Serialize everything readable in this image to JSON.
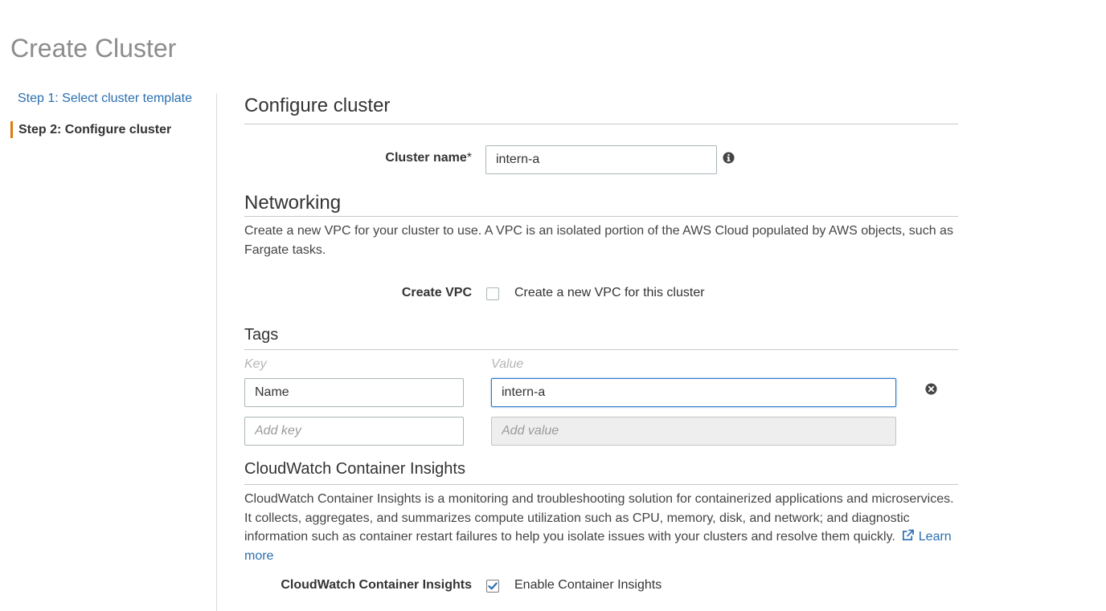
{
  "page": {
    "title": "Create Cluster"
  },
  "steps": [
    {
      "label": "Step 1: Select cluster template"
    },
    {
      "label": "Step 2: Configure cluster"
    }
  ],
  "configure": {
    "title": "Configure cluster",
    "cluster_name_label": "Cluster name",
    "required_mark": "*",
    "cluster_name_value": "intern-a"
  },
  "networking": {
    "title": "Networking",
    "description": "Create a new VPC for your cluster to use. A VPC is an isolated portion of the AWS Cloud populated by AWS objects, such as Fargate tasks.",
    "create_vpc_label": "Create VPC",
    "create_vpc_checkbox_label": "Create a new VPC for this cluster",
    "create_vpc_checked": false
  },
  "tags": {
    "title": "Tags",
    "key_header": "Key",
    "value_header": "Value",
    "rows": [
      {
        "key": "Name",
        "value": "intern-a"
      }
    ],
    "add_key_placeholder": "Add key",
    "add_value_placeholder": "Add value"
  },
  "insights": {
    "title": "CloudWatch Container Insights",
    "description": "CloudWatch Container Insights is a monitoring and troubleshooting solution for containerized applications and microservices. It collects, aggregates, and summarizes compute utilization such as CPU, memory, disk, and network; and diagnostic information such as container restart failures to help you isolate issues with your clusters and resolve them quickly.",
    "learn_more": "Learn more",
    "field_label": "CloudWatch Container Insights",
    "checkbox_label": "Enable Container Insights",
    "enabled": true
  },
  "icons": {
    "info": "info-icon",
    "remove": "remove-tag-icon",
    "external": "external-link-icon",
    "check": "checkmark-icon"
  },
  "colors": {
    "link": "#2a6fb0",
    "active_step_bar": "#e07a10",
    "focus_border": "#2e7bc6"
  }
}
